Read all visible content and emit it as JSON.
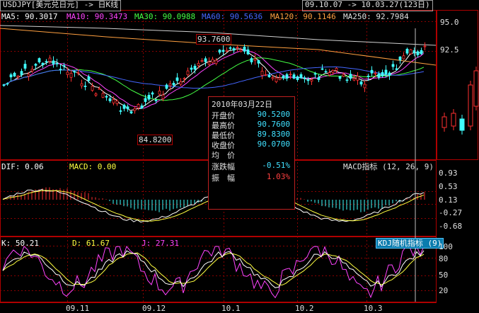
{
  "header": {
    "title": "USDJPY[美元兑日元] -> 日K线",
    "date_range": "09.10.07 -> 10.03.27(123日)",
    "ma": [
      {
        "label": "MA5: 90.3017",
        "color": "#ffffff"
      },
      {
        "label": "MA10: 90.3473",
        "color": "#ff44ff"
      },
      {
        "label": "MA30: 90.0988",
        "color": "#44ff44"
      },
      {
        "label": "MA60: 90.5636",
        "color": "#4466ff"
      },
      {
        "label": "MA120: 90.1146",
        "color": "#ffa040"
      },
      {
        "label": "MA250: 92.7984",
        "color": "#e0e0e0"
      }
    ]
  },
  "price_axis": {
    "labels": [
      "95.0",
      "92.5"
    ]
  },
  "annotations": {
    "high": "93.7600",
    "low": "84.8200"
  },
  "tooltip": {
    "date": "2010年03月22日",
    "rows": [
      {
        "label": "开盘价",
        "value": "90.5200",
        "color": "#40e0ff"
      },
      {
        "label": "最高价",
        "value": "90.7600",
        "color": "#40e0ff"
      },
      {
        "label": "最低价",
        "value": "89.8300",
        "color": "#40e0ff"
      },
      {
        "label": "收盘价",
        "value": "90.0700",
        "color": "#40e0ff"
      },
      {
        "label": "均　价",
        "value": "",
        "color": "#40e0ff"
      },
      {
        "label": "涨跌幅",
        "value": "-0.51%",
        "color": "#40e0ff"
      },
      {
        "label": "振　幅",
        "value": "1.03%",
        "color": "#ff4040"
      }
    ]
  },
  "macd": {
    "dif": "DIF: 0.06",
    "macd": "MACD: 0.00",
    "name": "MACD指标 (12, 26, 9)",
    "axis": [
      "0.93",
      "0.53",
      "0.13",
      "-0.27",
      "-0.68"
    ]
  },
  "kdj": {
    "k": "K: 50.21",
    "d": "D: 61.67",
    "j": "J: 27.31",
    "name": "KDJ随机指标 (9)",
    "axis": [
      "100",
      "80",
      "50",
      "20"
    ]
  },
  "time_axis": {
    "labels": [
      "09.11",
      "09.12",
      "10.1",
      "10.2",
      "10.3"
    ]
  },
  "colors": {
    "up": "#ff3030",
    "down": "#40ffff",
    "grid": "#8a0000",
    "bg": "#000000"
  }
}
